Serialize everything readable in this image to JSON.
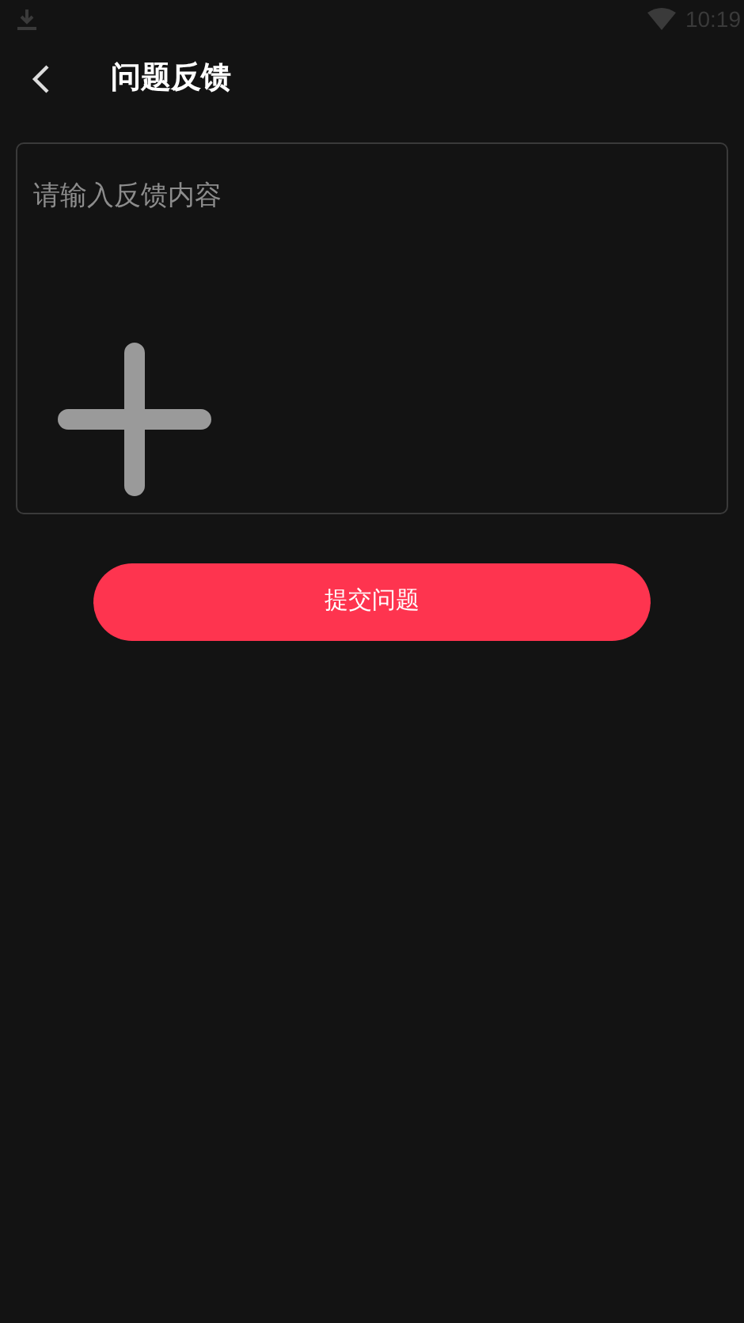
{
  "status_bar": {
    "time": "10:19"
  },
  "header": {
    "title": "问题反馈"
  },
  "feedback": {
    "placeholder": "请输入反馈内容"
  },
  "submit_button": {
    "label": "提交问题"
  }
}
